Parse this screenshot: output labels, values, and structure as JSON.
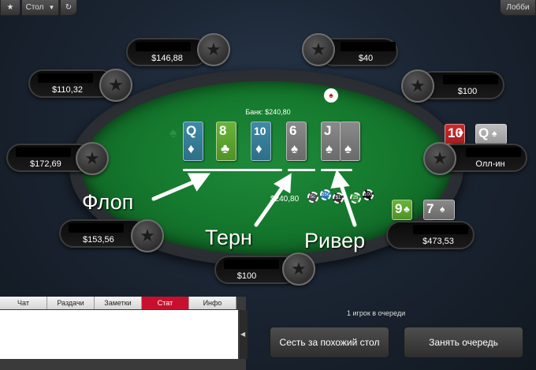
{
  "topbar": {
    "table_label": "Стол",
    "lobby_label": "Лобби"
  },
  "table": {
    "pot_label": "Банк: $240,80",
    "bet_amount": "$240,80"
  },
  "board": [
    {
      "rank": "Q",
      "suit": "♦",
      "color": "blue"
    },
    {
      "rank": "8",
      "suit": "♣",
      "color": "green"
    },
    {
      "rank": "10",
      "suit": "♦",
      "color": "blue"
    },
    {
      "rank": "6",
      "suit": "♠",
      "color": "gray"
    },
    {
      "rank": "J",
      "suit": "♠",
      "color": "gray"
    }
  ],
  "seats": [
    {
      "stack": "$146,88"
    },
    {
      "stack": "$40"
    },
    {
      "stack": "$110,32"
    },
    {
      "stack": "$100"
    },
    {
      "stack": "$172,69"
    },
    {
      "stack": "Олл-ин"
    },
    {
      "stack": "$153,56"
    },
    {
      "stack": "$473,53"
    },
    {
      "stack": "$100"
    }
  ],
  "hole_cards_right": [
    {
      "rank": "10",
      "suit": "♥",
      "color": "red"
    },
    {
      "rank": "Q",
      "suit": "♠",
      "color": "lightgray"
    }
  ],
  "hole_cards_bottom_right": [
    {
      "rank": "9",
      "suit": "♣",
      "color": "green"
    },
    {
      "rank": "7",
      "suit": "♠",
      "color": "gray"
    }
  ],
  "chips": [
    "5c",
    "25c",
    "$1",
    "25",
    "100"
  ],
  "annotations": {
    "flop": "Флоп",
    "turn": "Терн",
    "river": "Ривер"
  },
  "tabs": [
    "Чат",
    "Раздачи",
    "Заметки",
    "Стат",
    "Инфо"
  ],
  "active_tab": "Стат",
  "queue_text": "1 игрок в очереди",
  "buttons": {
    "sit_similar": "Сесть за похожий стол",
    "join_queue": "Занять очередь"
  }
}
